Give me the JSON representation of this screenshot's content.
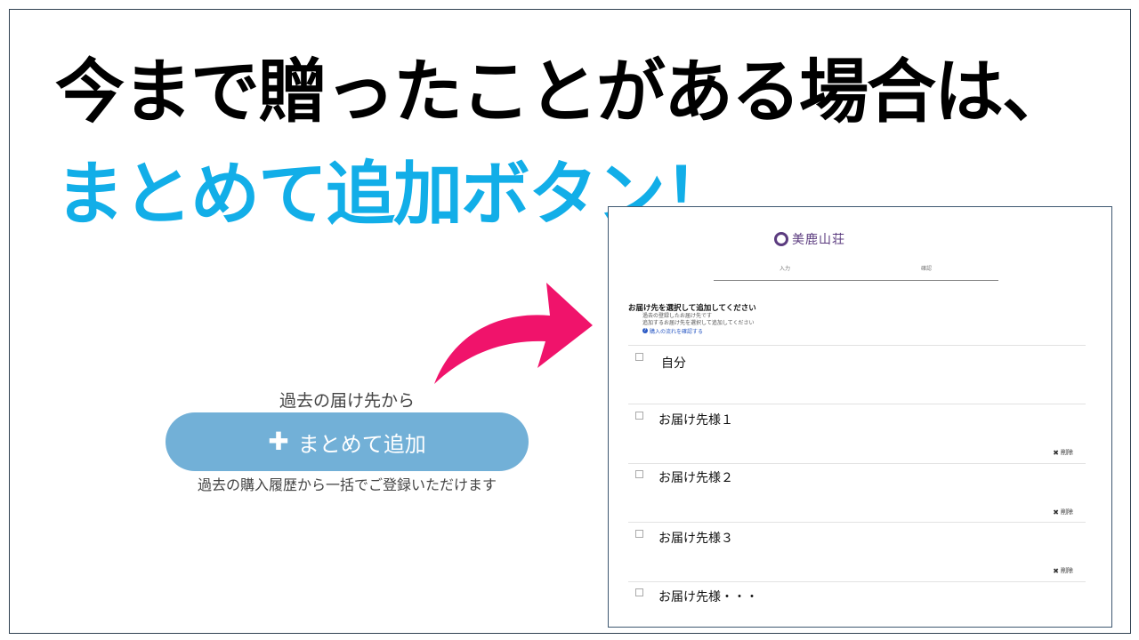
{
  "headline": {
    "line1": "今まで贈ったことがある場合は、",
    "line2": "まとめて追加ボタン！"
  },
  "colors": {
    "highlight": "#12aee8",
    "arrow": "#f0136b",
    "button": "#72b0d7",
    "logo": "#5b3b7f"
  },
  "cta": {
    "caption_top": "過去の届け先から",
    "button_icon": "plus-icon",
    "button_label": "まとめて追加",
    "caption_bottom": "過去の購入履歴から一括でご登録いただけます"
  },
  "screenshot": {
    "logo_text": "美鹿山荘",
    "steps": [
      "入力",
      "確認"
    ],
    "title": "お届け先を選択して追加してください",
    "lines": [
      "過去の登録したお届け先です",
      "追加するお届け先を選択して追加してください"
    ],
    "help_link": "購入の流れを確認する",
    "rows": [
      {
        "label": "自分",
        "delete": ""
      },
      {
        "label": "お届け先様１",
        "delete": "削除"
      },
      {
        "label": "お届け先様２",
        "delete": "削除"
      },
      {
        "label": "お届け先様３",
        "delete": "削除"
      },
      {
        "label": "お届け先様・・・",
        "delete": ""
      }
    ]
  }
}
